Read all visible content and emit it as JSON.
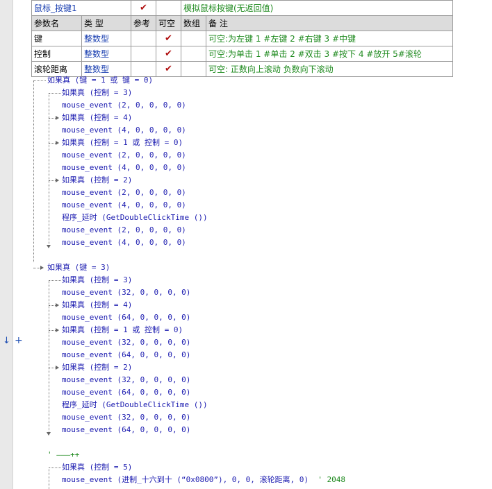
{
  "subroutine": {
    "header": {
      "name": "鼠标_按键1",
      "public_check": "✔",
      "comment": "模拟鼠标按键(无返回值)"
    },
    "param_headers": [
      "参数名",
      "类 型",
      "参考",
      "可空",
      "数组",
      "备 注"
    ],
    "params": [
      {
        "name": "键",
        "type": "整数型",
        "optional": "✔",
        "comment": "可空:为左键  1 #左键   2 #右键   3 #中键"
      },
      {
        "name": "控制",
        "type": "整数型",
        "optional": "✔",
        "comment": "可空:为单击  1 #单击   2 #双击   3 #按下  4 #放开  5#滚轮"
      },
      {
        "name": "滚轮距离",
        "type": "整数型",
        "optional": "✔",
        "comment": "可空: 正数向上滚动 负数向下滚动"
      }
    ]
  },
  "gutter": {
    "breakpoint_arrow": "↓",
    "expand_plus": "+"
  },
  "code": [
    {
      "kw": "如果真",
      "rest": " (键 = 1 或 键 = 0)"
    },
    {
      "kw": "如果真",
      "rest": " (控制 = 3)"
    },
    {
      "fn": "mouse_event (2, 0, 0, 0, 0)"
    },
    {
      "kw": "如果真",
      "rest": " (控制 = 4)"
    },
    {
      "fn": "mouse_event (4, 0, 0, 0, 0)"
    },
    {
      "kw": "如果真",
      "rest": " (控制 = 1 或 控制 = 0)"
    },
    {
      "fn": "mouse_event (2, 0, 0, 0, 0)"
    },
    {
      "fn": "mouse_event (4, 0, 0, 0, 0)"
    },
    {
      "kw": "如果真",
      "rest": " (控制 = 2)"
    },
    {
      "fn": "mouse_event (2, 0, 0, 0, 0)"
    },
    {
      "fn": "mouse_event (4, 0, 0, 0, 0)"
    },
    {
      "fn": "程序_延时 (GetDoubleClickTime ())"
    },
    {
      "fn": "mouse_event (2, 0, 0, 0, 0)"
    },
    {
      "fn": "mouse_event (4, 0, 0, 0, 0)"
    },
    {
      "kw": "如果真",
      "rest": " (键 = 3)"
    },
    {
      "kw": "如果真",
      "rest": " (控制 = 3)"
    },
    {
      "fn": "mouse_event (32, 0, 0, 0, 0)"
    },
    {
      "kw": "如果真",
      "rest": " (控制 = 4)"
    },
    {
      "fn": "mouse_event (64, 0, 0, 0, 0)"
    },
    {
      "kw": "如果真",
      "rest": " (控制 = 1 或 控制 = 0)"
    },
    {
      "fn": "mouse_event (32, 0, 0, 0, 0)"
    },
    {
      "fn": "mouse_event (64, 0, 0, 0, 0)"
    },
    {
      "kw": "如果真",
      "rest": " (控制 = 2)"
    },
    {
      "fn": "mouse_event (32, 0, 0, 0, 0)"
    },
    {
      "fn": "mouse_event (64, 0, 0, 0, 0)"
    },
    {
      "fn": "程序_延时 (GetDoubleClickTime ())"
    },
    {
      "fn": "mouse_event (32, 0, 0, 0, 0)"
    },
    {
      "fn": "mouse_event (64, 0, 0, 0, 0)"
    },
    {
      "cm": "' ———++"
    },
    {
      "kw": "如果真",
      "rest": " (控制 = 5)"
    },
    {
      "fn": "mouse_event (进制_十六到十 (“0x0800”), 0, 0, 滚轮距离, 0)",
      "cm2": "' 2048"
    }
  ]
}
